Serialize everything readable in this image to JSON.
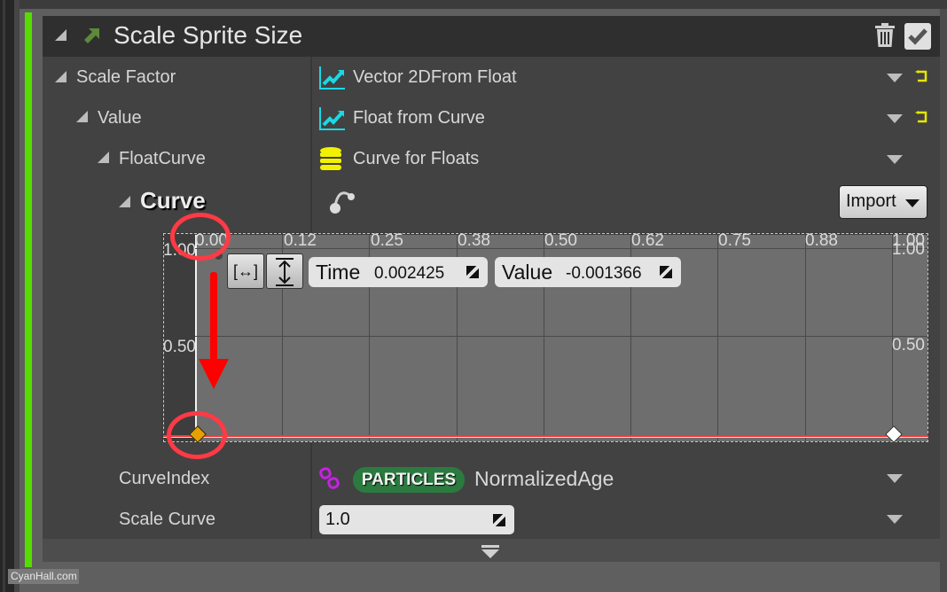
{
  "module": {
    "title": "Scale Sprite Size",
    "accent_color": "#57dc00",
    "enabled": true
  },
  "rows": [
    {
      "label": "Scale Factor",
      "value": "Vector 2DFrom Float",
      "icon": "dynamic-input-icon"
    },
    {
      "label": "Value",
      "value": "Float from Curve",
      "icon": "dynamic-input-icon"
    },
    {
      "label": "FloatCurve",
      "value": "Curve for Floats",
      "icon": "data-stack-icon"
    },
    {
      "label": "Curve"
    },
    {
      "label": "CurveIndex",
      "badge": "PARTICLES",
      "value": "NormalizedAge",
      "icon": "link-icon"
    },
    {
      "label": "Scale Curve",
      "value": "1.0"
    }
  ],
  "curve_editor": {
    "import_label": "Import",
    "time_label": "Time",
    "time_value": "0.002425",
    "value_label": "Value",
    "value_value": "-0.001366",
    "x_ticks": [
      "0.00",
      "0.12",
      "0.25",
      "0.38",
      "0.50",
      "0.62",
      "0.75",
      "0.88",
      "1.00"
    ],
    "y_ticks_left": [
      "1.00",
      "0.50"
    ],
    "y_ticks_right": [
      "1.00",
      "0.50"
    ],
    "keys": [
      {
        "time": 0.002425,
        "value": -0.001366,
        "selected": true
      },
      {
        "time": 1.0,
        "value": 0.0,
        "selected": false
      }
    ],
    "curve_color": "#ff3333",
    "selected_key_color": "#e6a000"
  },
  "watermark": "CyanHall.com"
}
